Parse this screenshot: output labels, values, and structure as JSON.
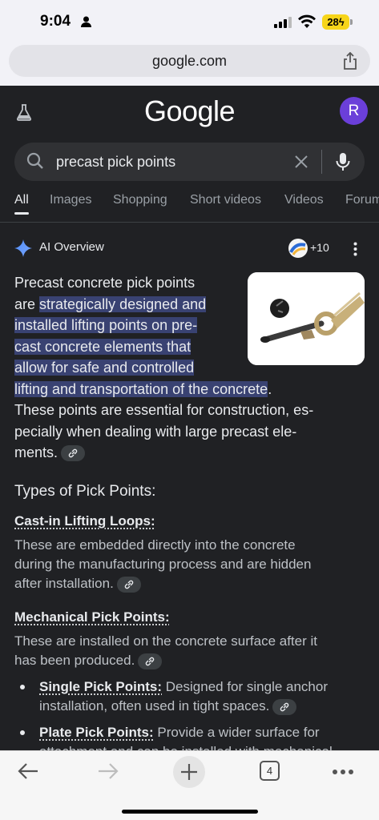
{
  "status_bar": {
    "time": "9:04",
    "battery": "28"
  },
  "browser": {
    "url": "google.com",
    "open_tabs": "4"
  },
  "google": {
    "logo": "Google",
    "avatar_initial": "R",
    "search_query": "precast pick points",
    "tabs": [
      "All",
      "Images",
      "Shopping",
      "Short videos",
      "Videos",
      "Forum"
    ]
  },
  "ai_overview": {
    "title": "AI Overview",
    "sources_count": "+10",
    "intro_lines": [
      {
        "plain": "Precast concrete pick points"
      },
      {
        "plain": "are ",
        "hl": "strategically designed and"
      },
      {
        "hl": "installed lifting points on pre-"
      },
      {
        "hl": "cast concrete elements that"
      },
      {
        "hl": "allow for safe and controlled"
      },
      {
        "hl": "lifting and transportation of the concrete",
        "plain": "."
      },
      {
        "plain": "These points are essential for construction, es-"
      },
      {
        "plain": "pecially when dealing with large precast ele-"
      },
      {
        "plain": "ments."
      }
    ],
    "section_title": "Types of Pick Points:",
    "cast_in": {
      "title": "Cast-in Lifting Loops:",
      "lines": [
        "These are embedded directly into the concrete",
        "during the manufacturing process and are hidden",
        "after installation."
      ]
    },
    "mechanical": {
      "title": "Mechanical Pick Points:",
      "lines": [
        "These are installed on the concrete surface after it",
        "has been produced."
      ]
    },
    "bullets": [
      {
        "term": "Single Pick Points:",
        "line1": " Designed for single anchor",
        "line2": "installation, often used in tight spaces."
      },
      {
        "term": "Plate Pick Points:",
        "line1": " Provide a wider surface for",
        "line2": "attachment and can be installed with mechanical"
      }
    ]
  }
}
